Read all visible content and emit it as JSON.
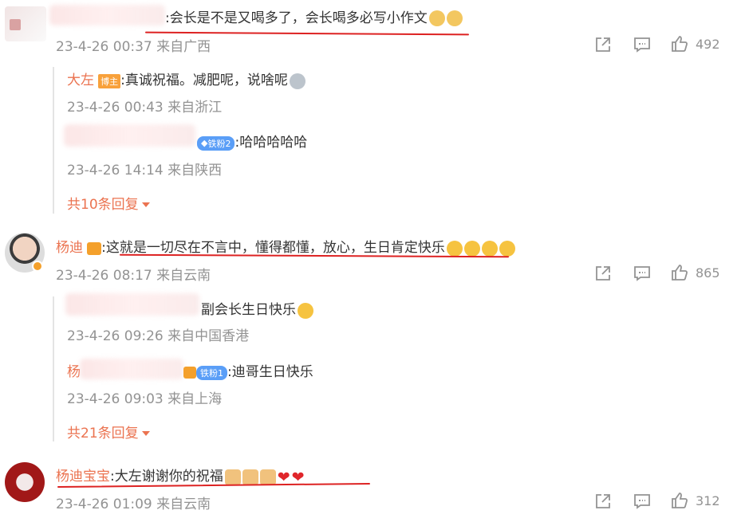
{
  "comments": [
    {
      "author": "",
      "text": ":会长是不是又喝多了，会长喝多必写小作文",
      "time": "23-4-26 00:37",
      "location": "来自广西",
      "likes": "492",
      "replies": [
        {
          "author": "大左",
          "badge": "博主",
          "text": ":真诚祝福。减肥呢，说啥呢",
          "time": "23-4-26 00:43",
          "location": "来自浙江"
        },
        {
          "author": "",
          "badge": "铁粉2",
          "text": ":哈哈哈哈哈",
          "time": "23-4-26 14:14",
          "location": "来自陕西"
        }
      ],
      "more": "共10条回复"
    },
    {
      "author": "杨迪",
      "text": ":这就是一切尽在不言中，懂得都懂，放心，生日肯定快乐",
      "time": "23-4-26 08:17",
      "location": "来自云南",
      "likes": "865",
      "replies": [
        {
          "author": "",
          "badge": "",
          "text": "副会长生日快乐",
          "time": "23-4-26 09:26",
          "location": "来自中国香港"
        },
        {
          "author": "杨",
          "badge": "铁粉1",
          "text": ":迪哥生日快乐",
          "time": "23-4-26 09:03",
          "location": "来自上海"
        }
      ],
      "more": "共21条回复"
    },
    {
      "author": "杨迪宝宝",
      "text": ":大左谢谢你的祝福",
      "time": "23-4-26 01:09",
      "location": "来自云南",
      "likes": "312"
    }
  ],
  "colors": {
    "name": "#eb7350",
    "meta": "#939393",
    "underline": "#dd2222",
    "host_badge": "#f8a13b",
    "fan_badge": "#5a9ef7"
  }
}
